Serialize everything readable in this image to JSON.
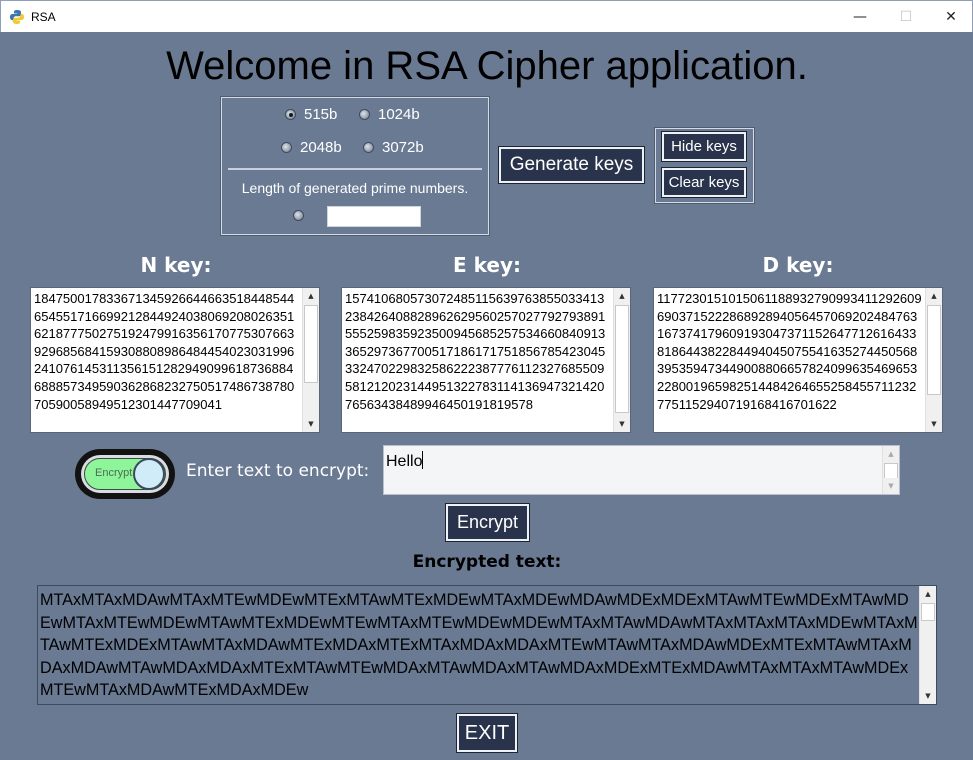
{
  "window": {
    "title": "RSA",
    "minimize_glyph": "—",
    "maximize_glyph": "☐",
    "close_glyph": "✕"
  },
  "heading": "Welcome in RSA Cipher application.",
  "key_length": {
    "options": [
      "515b",
      "1024b",
      "2048b",
      "3072b"
    ],
    "selected": "515b",
    "prime_label": "Length of generated prime numbers.",
    "prime_value": ""
  },
  "buttons": {
    "generate": "Generate keys",
    "hide": "Hide keys",
    "clear": "Clear keys",
    "encrypt": "Encrypt",
    "exit": "EXIT"
  },
  "keys": {
    "n": {
      "label": "N key:",
      "value": "18475001783367134592664466351844854465455171669921284492403806920802635162187775027519247991635617077530766392968568415930880898648445402303199624107614531135615128294909961873688468885734959036286823275051748673878070590058949512301447709041"
    },
    "e": {
      "label": "E key:",
      "value": "15741068057307248511563976385503341323842640882896262956025702779279389155525983592350094568525753466084091336529736770051718617175185678542304533247022983258622238777611232768550958121202314495132278311413694732142076563438489946450191819578"
    },
    "d": {
      "label": "D key:",
      "value": "11772301510150611889327909934112926096903715222868928940564570692024847631673741796091930473711526477126164338186443822844940450755416352744505683953594734490088066578240996354696532280019659825144842646552584557112327751152940719168416701622"
    }
  },
  "encrypt": {
    "toggle_label": "Encrypt",
    "prompt": "Enter text to encrypt:",
    "input_value": "Hello",
    "output_label": "Encrypted text:",
    "output_value": "MTAxMTAxMDAwMTAxMTEwMDEwMTExMTAwMTExMDEwMTAxMDEwMDAwMDExMDExMTAwMTEwMDExMTAwMDEwMTAxMTEwMDEwMTAwMTExMDEwMTEwMTAxMTEwMDEwMDEwMTAxMTAwMDAwMTAxMTAxMTAxMDEwMTAxMTAwMTExMDExMTAwMTAxMDAwMTExMDAxMTExMTAxMDAxMDAxMTEwMTAwMTAxMDAwMDExMTExMTAwMTAxMDAxMDAwMTAwMDAxMDAxMTExMTAwMTEwMDAxMTAwMDAxMTAwMDAxMDExMTExMDAwMTAxMTAxMTAwMDExMTEwMTAxMDAwMTExMDAxMDEw"
  },
  "colors": {
    "background": "#697a92",
    "button": "#29344c",
    "toggle_on": "#8ef59b"
  }
}
